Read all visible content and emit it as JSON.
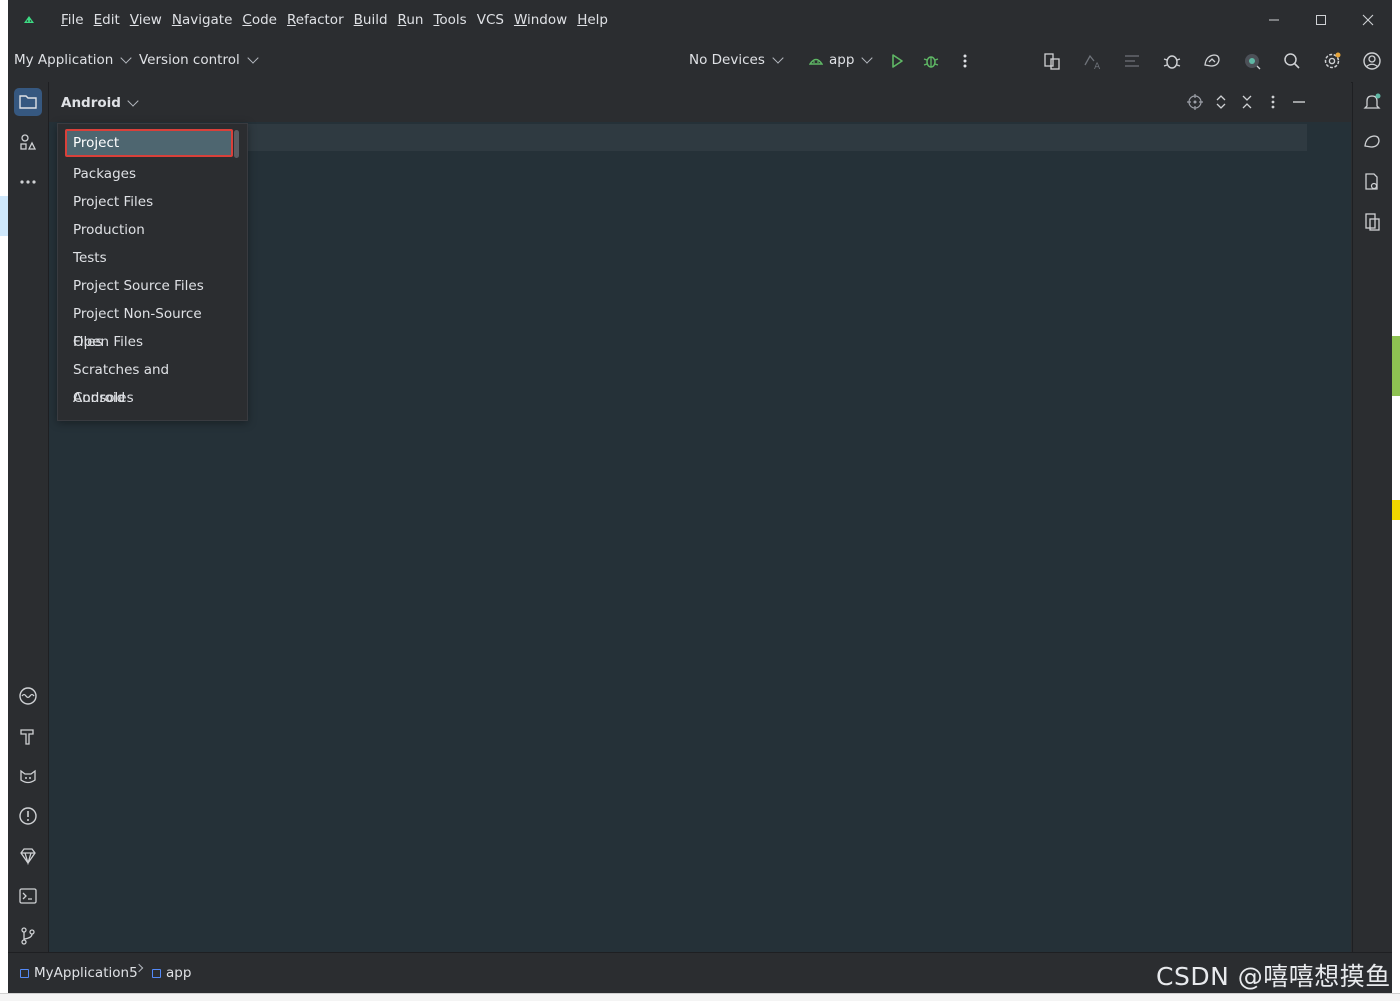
{
  "menu": {
    "items": [
      "File",
      "Edit",
      "View",
      "Navigate",
      "Code",
      "Refactor",
      "Build",
      "Run",
      "Tools",
      "VCS",
      "Window",
      "Help"
    ]
  },
  "toolbar": {
    "project_name": "My Application",
    "version_control": "Version control",
    "devices": "No Devices",
    "run_config": "app"
  },
  "tool_window": {
    "title": "Android"
  },
  "view_popup": {
    "items": [
      "Project",
      "Packages",
      "Project Files",
      "Production",
      "Tests",
      "Project Source Files",
      "Project Non-Source Files",
      "Open Files",
      "Scratches and Consoles",
      "Android"
    ],
    "selected": "Project"
  },
  "status": {
    "crumb_project": "MyApplication5",
    "crumb_module": "app"
  },
  "watermark": "CSDN @嘻嘻想摸鱼",
  "colors": {
    "ide_bg": "#2b2d30",
    "content_bg": "#253138",
    "selection_bg": "#4e6670",
    "highlight_border": "#d9403a",
    "run_green": "#5fb865",
    "accent_blue": "#548af7"
  }
}
